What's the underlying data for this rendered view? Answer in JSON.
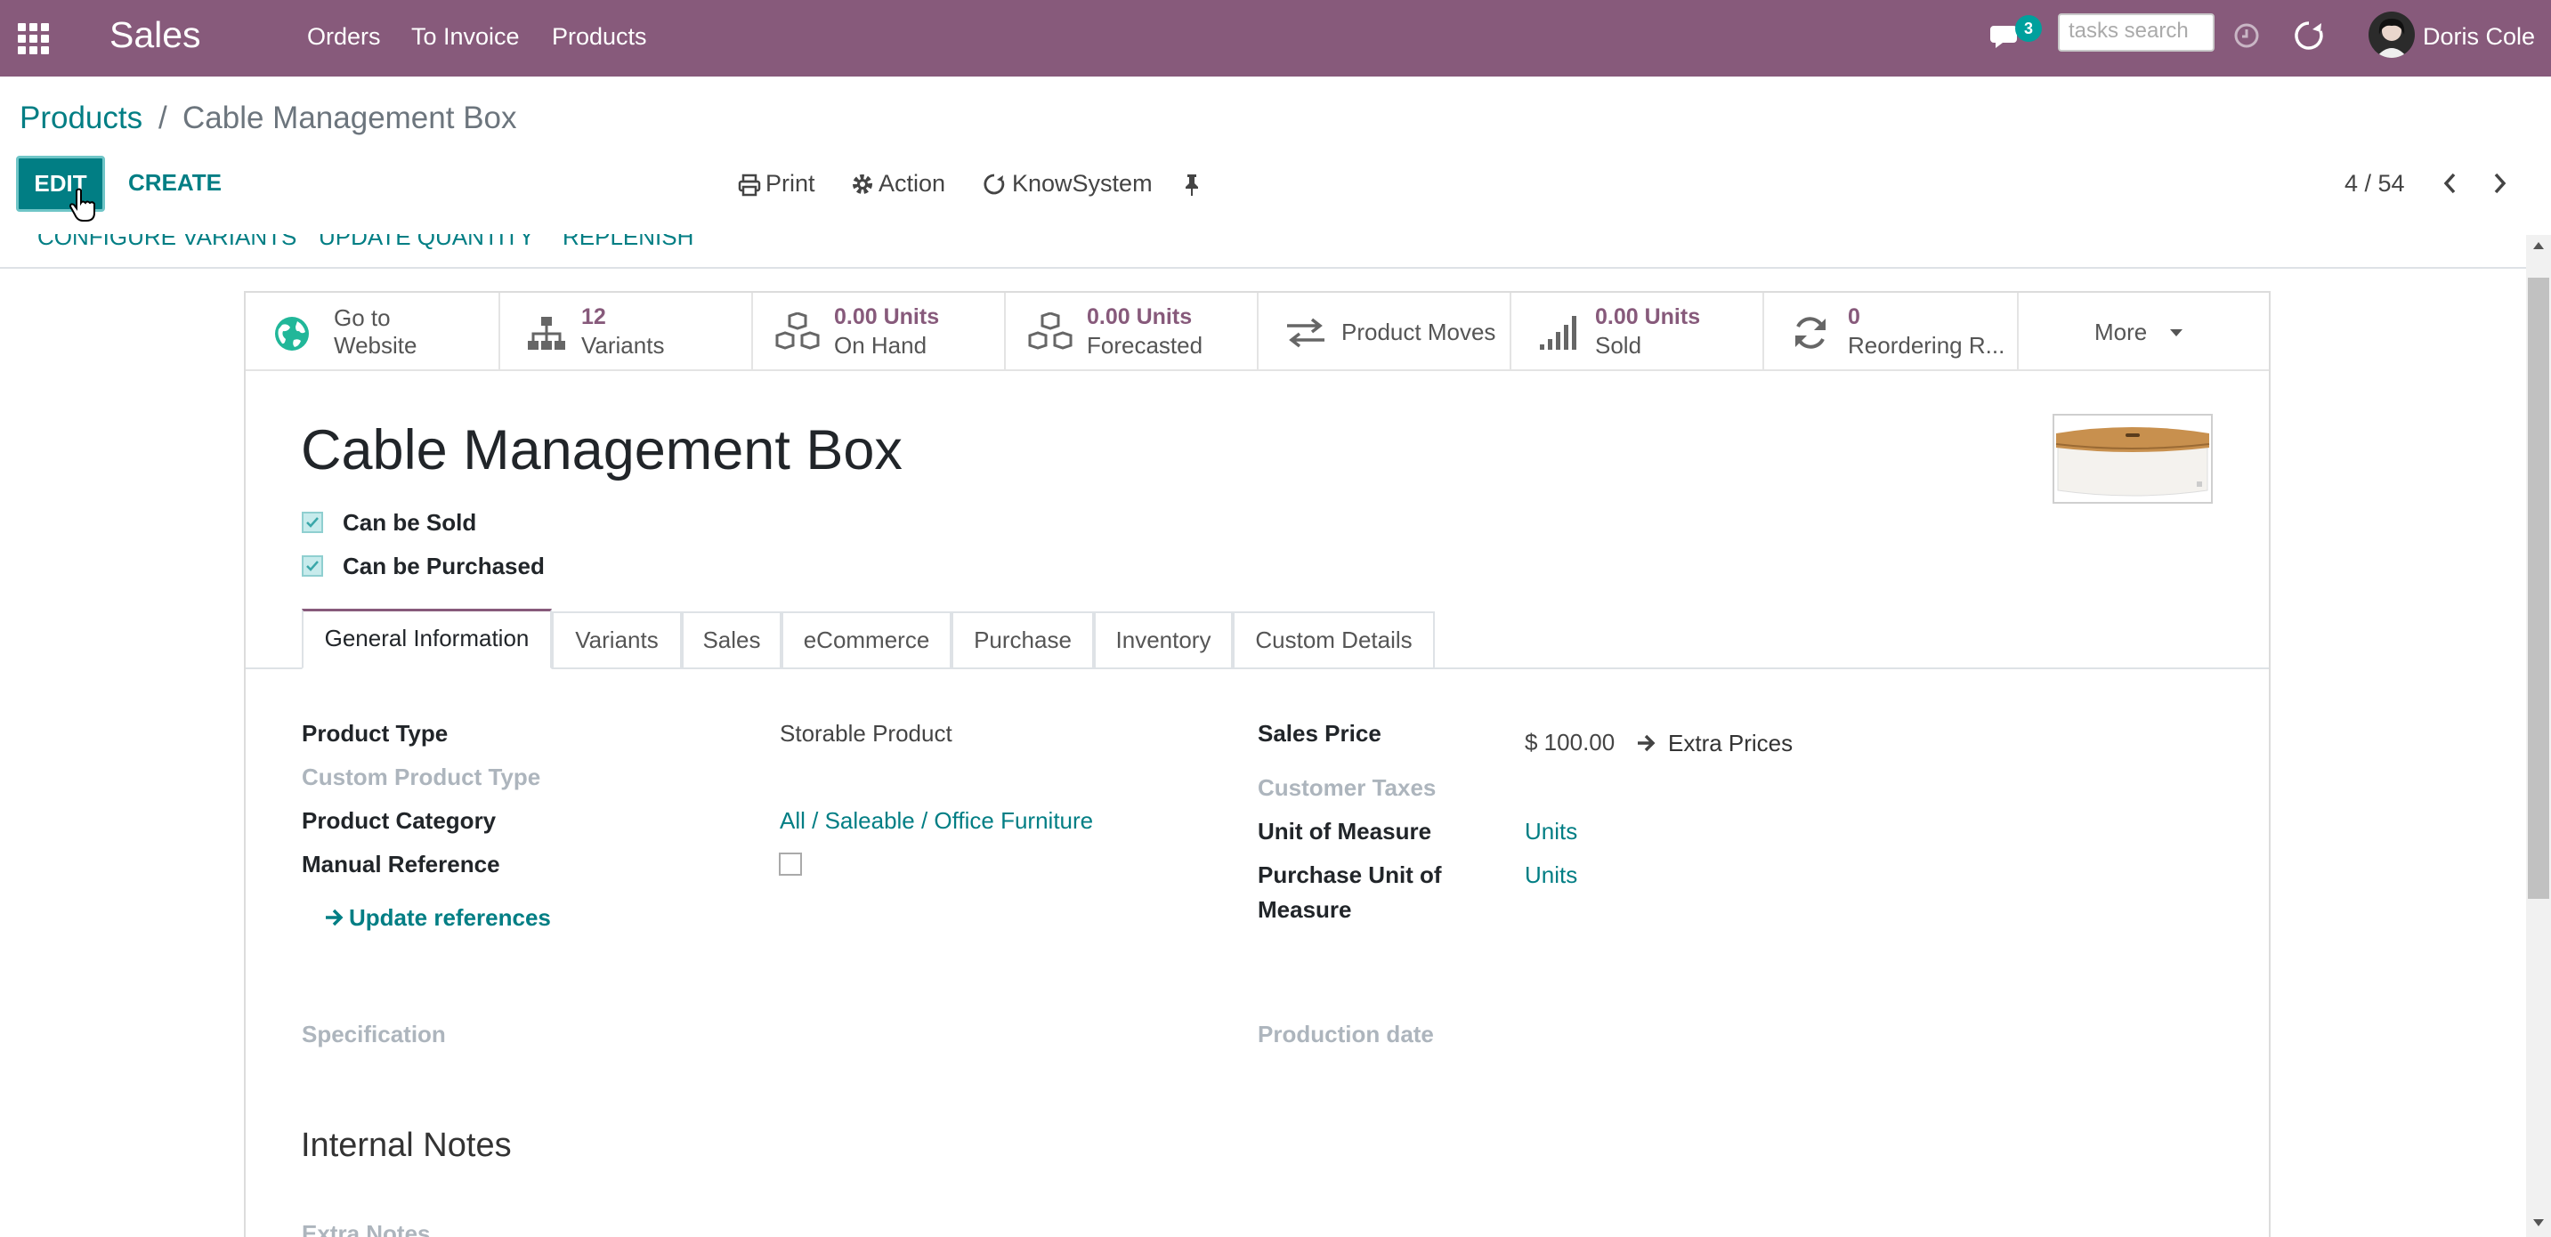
{
  "navbar": {
    "brand": "Sales",
    "menu": [
      "Orders",
      "To Invoice",
      "Products"
    ],
    "messages_count": "3",
    "search_placeholder": "tasks search",
    "user_name": "Doris Cole",
    "bg_color": "#875a7b"
  },
  "breadcrumb": {
    "parent": "Products",
    "separator": "/",
    "current": "Cable Management Box"
  },
  "toolbar": {
    "edit_label": "EDIT",
    "create_label": "CREATE",
    "print_label": "Print",
    "action_label": "Action",
    "knowsystem_label": "KnowSystem",
    "pager": "4 / 54"
  },
  "header_buttons": [
    "CONFIGURE VARIANTS",
    "UPDATE QUANTITY",
    "REPLENISH"
  ],
  "smart_buttons": {
    "website": {
      "line1": "Go to",
      "line2": "Website"
    },
    "variants": {
      "value": "12",
      "label": "Variants"
    },
    "on_hand": {
      "value": "0.00 Units",
      "label": "On Hand"
    },
    "forecasted": {
      "value": "0.00 Units",
      "label": "Forecasted"
    },
    "moves": {
      "label": "Product Moves"
    },
    "sold": {
      "value": "0.00 Units",
      "label": "Sold"
    },
    "reordering": {
      "value": "0",
      "label": "Reordering R..."
    },
    "more": {
      "label": "More"
    }
  },
  "product": {
    "name": "Cable Management Box",
    "can_be_sold": "Can be Sold",
    "can_be_purchased": "Can be Purchased"
  },
  "tabs": [
    "General Information",
    "Variants",
    "Sales",
    "eCommerce",
    "Purchase",
    "Inventory",
    "Custom Details"
  ],
  "active_tab": "General Information",
  "fields_left": {
    "product_type_label": "Product Type",
    "product_type_value": "Storable Product",
    "custom_type_label": "Custom Product Type",
    "category_label": "Product Category",
    "category_value": "All / Saleable / Office Furniture",
    "manual_ref_label": "Manual Reference",
    "update_refs": "Update references",
    "specification_label": "Specification"
  },
  "fields_right": {
    "sales_price_label": "Sales Price",
    "sales_price_value": "$ 100.00",
    "extra_prices": "Extra Prices",
    "taxes_label": "Customer Taxes",
    "uom_label": "Unit of Measure",
    "uom_value": "Units",
    "purchase_uom_label_1": "Purchase Unit of",
    "purchase_uom_label_2": "Measure",
    "purchase_uom_value": "Units",
    "production_date_label": "Production date"
  },
  "notes": {
    "title": "Internal Notes",
    "extra_notes_label": "Extra Notes"
  }
}
